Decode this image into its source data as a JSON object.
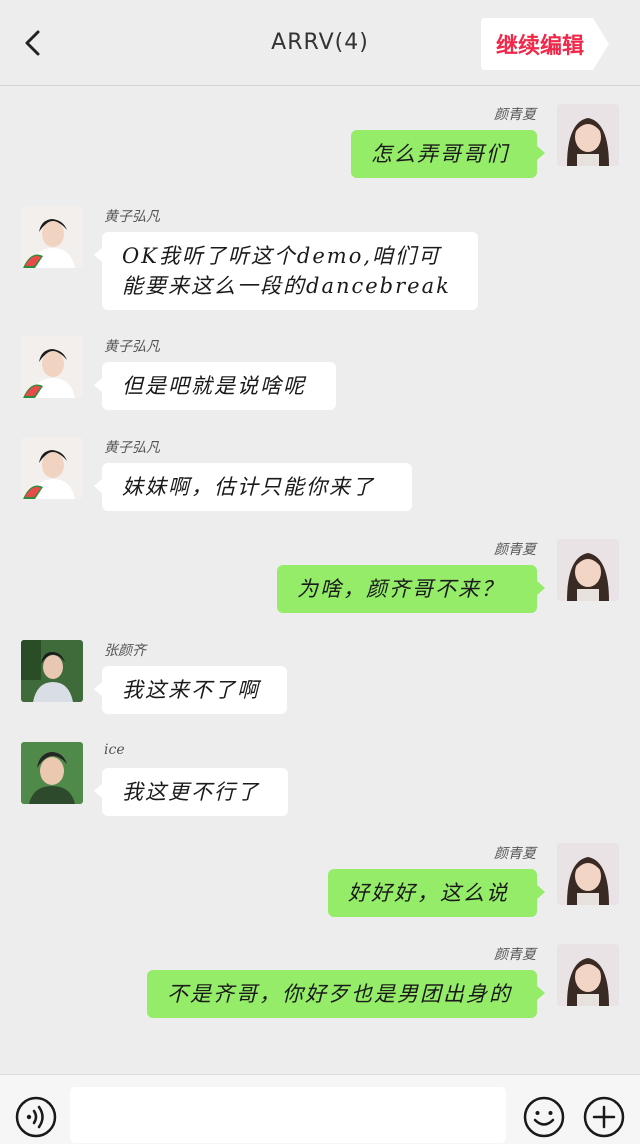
{
  "header": {
    "title": "ARRV(4)",
    "edit_label": "继续编辑",
    "icons": {
      "back": "chevron-left-icon"
    }
  },
  "messages": [
    {
      "side": "right",
      "name": "颜青夏",
      "text": "怎么弄哥哥们",
      "avatar": "girl-avatar"
    },
    {
      "side": "left",
      "name": "黄子弘凡",
      "text": "OK我听了听这个demo,咱们可能要来这么一段的dancebreak",
      "avatar": "boy-watermelon-avatar"
    },
    {
      "side": "left",
      "name": "黄子弘凡",
      "text": "但是吧就是说啥呢",
      "avatar": "boy-watermelon-avatar"
    },
    {
      "side": "left",
      "name": "黄子弘凡",
      "text": "妹妹啊，估计只能你来了",
      "avatar": "boy-watermelon-avatar"
    },
    {
      "side": "right",
      "name": "颜青夏",
      "text": "为啥，颜齐哥不来？",
      "avatar": "girl-avatar"
    },
    {
      "side": "left",
      "name": "张颜齐",
      "text": "我这来不了啊",
      "avatar": "boy-green-avatar"
    },
    {
      "side": "left",
      "name": "ice",
      "text": "我这更不行了",
      "avatar": "boy-ice-avatar"
    },
    {
      "side": "right",
      "name": "颜青夏",
      "text": "好好好，这么说",
      "avatar": "girl-avatar"
    },
    {
      "side": "right",
      "name": "颜青夏",
      "text": "不是齐哥，你好歹也是男团出身的",
      "avatar": "girl-avatar"
    }
  ],
  "bottombar": {
    "voice_icon": "voice-icon",
    "emoji_icon": "emoji-icon",
    "plus_icon": "plus-icon",
    "input_value": ""
  },
  "colors": {
    "background": "#ededed",
    "bubble_right": "#95ec69",
    "bubble_left": "#ffffff",
    "accent_edit": "#f0284a"
  }
}
